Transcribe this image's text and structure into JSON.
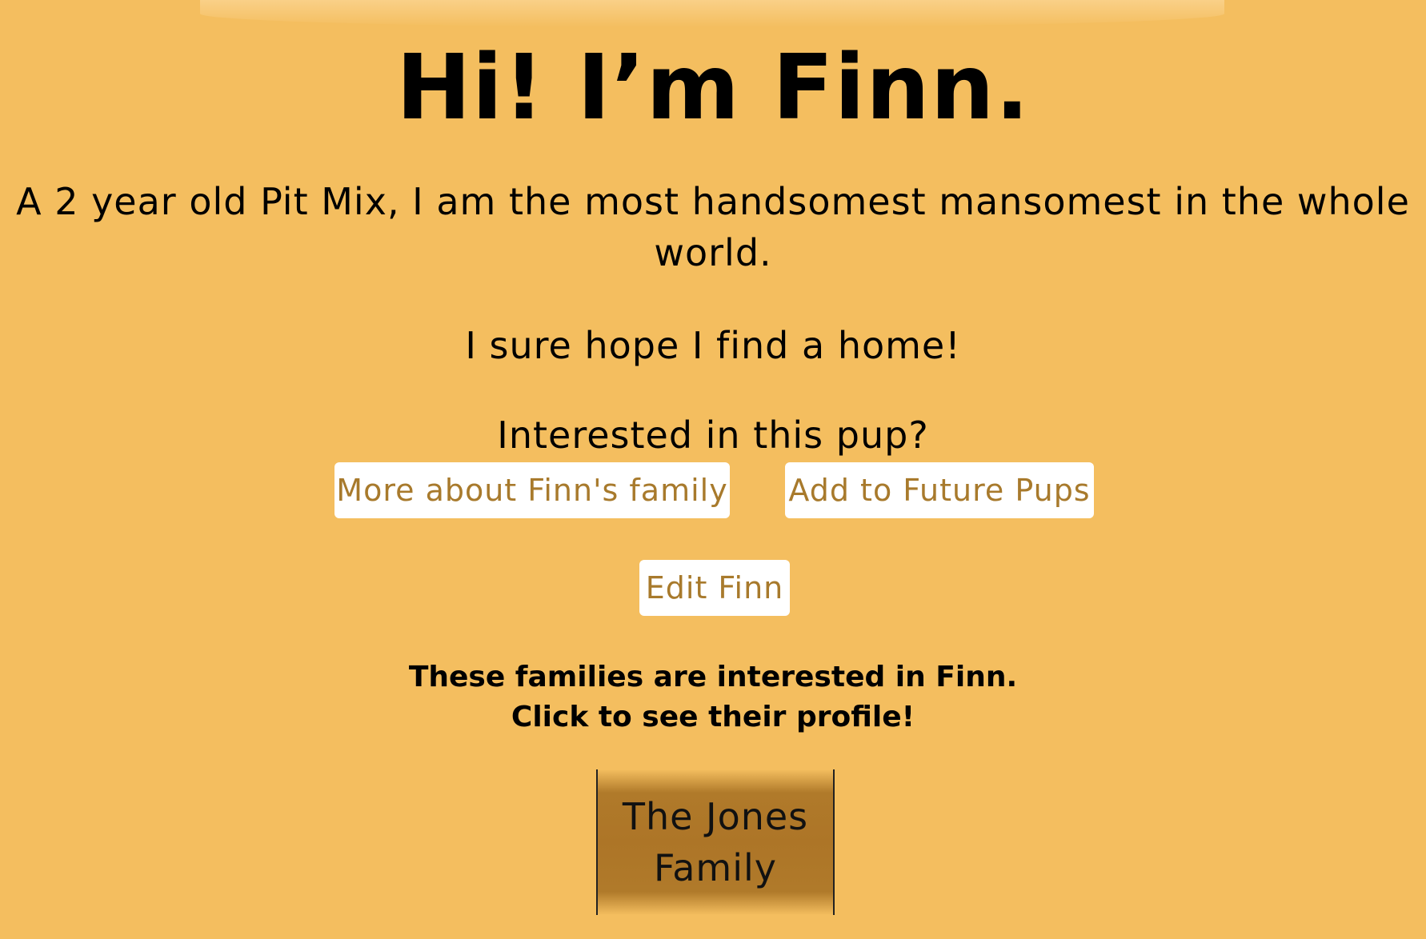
{
  "profile": {
    "title": "Hi! I’m Finn.",
    "description": "A 2 year old Pit Mix, I am the most handsomest mansomest in the whole world.",
    "hope": "I sure hope I find a home!",
    "interested_prompt": "Interested in this pup?"
  },
  "actions": {
    "family_button": "More about Finn's family",
    "future_pups_button": "Add to Future Pups",
    "edit_button": "Edit Finn"
  },
  "families": {
    "note_line1": "These families are interested in Finn.",
    "note_line2": "Click to see their profile!",
    "items": [
      {
        "name_line1": "The Jones",
        "name_line2": "Family"
      }
    ]
  },
  "colors": {
    "background": "#f4be5f",
    "button_text": "#a87a2c",
    "card": "#ad7527"
  }
}
